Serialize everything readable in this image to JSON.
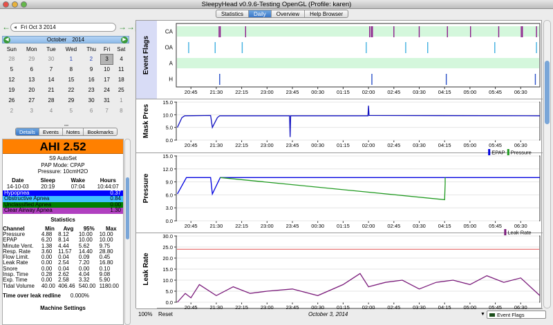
{
  "window": {
    "title": "SleepyHead v0.9.6-Testing OpenGL (Profile: karen)"
  },
  "tabs": [
    "Statistics",
    "Daily",
    "Overview",
    "Help Browser"
  ],
  "selected_tab": "Daily",
  "date_field": "Fri Oct 3 2014",
  "calendar": {
    "month": "October",
    "year": "2014",
    "weekdays": [
      "Sun",
      "Mon",
      "Tue",
      "Wed",
      "Thu",
      "Fri",
      "Sat"
    ],
    "weeks": [
      [
        "28",
        "29",
        "30",
        "1",
        "2",
        "3",
        "4"
      ],
      [
        "5",
        "6",
        "7",
        "8",
        "9",
        "10",
        "11"
      ],
      [
        "12",
        "13",
        "14",
        "15",
        "16",
        "17",
        "18"
      ],
      [
        "19",
        "20",
        "21",
        "22",
        "23",
        "24",
        "25"
      ],
      [
        "26",
        "27",
        "28",
        "29",
        "30",
        "31",
        "1"
      ],
      [
        "2",
        "3",
        "4",
        "5",
        "6",
        "7",
        "8"
      ]
    ],
    "selected": "3"
  },
  "left_tabs": [
    "Details",
    "Events",
    "Notes",
    "Bookmarks"
  ],
  "details": {
    "ahi_label": "AHI 2.52",
    "ahi_color": "#ff8000",
    "machine": "S9 AutoSet",
    "pap_mode": "PAP Mode: CPAP",
    "pressure": "Pressure: 10cmH2O",
    "session_headers": [
      "Date",
      "Sleep",
      "Wake",
      "Hours"
    ],
    "session_values": [
      "14-10-03",
      "20:19",
      "07:04",
      "10:44:07"
    ],
    "indices": [
      {
        "label": "Hypopnea",
        "value": "0.37",
        "color": "#0000ff",
        "text": "#ffffff"
      },
      {
        "label": "Obstructive Apnea",
        "value": "0.84",
        "color": "#40c0ff",
        "text": "#000000"
      },
      {
        "label": "Unclassified Apnea",
        "value": "0.00",
        "color": "#008000",
        "text": "#000000"
      },
      {
        "label": "Clear Airway Apnea",
        "value": "1.30",
        "color": "#b040c0",
        "text": "#000000"
      }
    ],
    "stats_title": "Statistics",
    "stats_headers": [
      "Channel",
      "Min",
      "Avg",
      "95%",
      "Max"
    ],
    "stats_rows": [
      [
        "Pressure",
        "4.88",
        "8.12",
        "10.00",
        "10.00"
      ],
      [
        "EPAP",
        "6.20",
        "8.14",
        "10.00",
        "10.00"
      ],
      [
        "Minute Vent.",
        "1.38",
        "4.44",
        "5.62",
        "9.75"
      ],
      [
        "Resp. Rate",
        "3.60",
        "11.57",
        "14.40",
        "28.80"
      ],
      [
        "Flow Limit.",
        "0.00",
        "0.04",
        "0.09",
        "0.45"
      ],
      [
        "Leak Rate",
        "0.00",
        "2.54",
        "7.20",
        "16.80"
      ],
      [
        "Snore",
        "0.00",
        "0.04",
        "0.00",
        "0.10"
      ],
      [
        "Insp. Time",
        "0.28",
        "2.62",
        "4.04",
        "9.08"
      ],
      [
        "Exp. Time",
        "0.00",
        "2.58",
        "3.32",
        "5.90"
      ],
      [
        "Tidal Volume",
        "40.00",
        "406.46",
        "540.00",
        "1180.00"
      ]
    ],
    "leak_label": "Time over leak redline",
    "leak_value": "0.000%",
    "machine_settings": "Machine Settings"
  },
  "time_ticks": [
    "20:45",
    "21:30",
    "22:15",
    "23:00",
    "23:45",
    "00:30",
    "01:15",
    "02:00",
    "02:45",
    "03:30",
    "04:15",
    "05:00",
    "05:45",
    "06:30"
  ],
  "chart_data": [
    {
      "type": "event-flags",
      "title": "Event Flags",
      "rows": [
        "CA",
        "OA",
        "A",
        "H"
      ],
      "colors": {
        "CA": "#8b1a8b",
        "OA": "#40b0e0",
        "H": "#2a50c8"
      },
      "events": {
        "CA": [
          "21:35",
          "21:37",
          "22:22",
          "02:02",
          "02:05",
          "02:07",
          "02:45",
          "03:30",
          "04:20",
          "05:01",
          "05:51",
          "06:31",
          "06:33",
          "06:58"
        ],
        "OA": [
          "20:41",
          "21:28",
          "22:16",
          "01:56",
          "03:06",
          "03:45",
          "05:44",
          "06:58"
        ],
        "H": [
          "21:36",
          "02:06",
          "04:18",
          "06:56"
        ]
      }
    },
    {
      "type": "line",
      "title": "Mask Pres",
      "ylim": [
        0,
        15
      ],
      "yticks": [
        "0.0",
        "5.0",
        "10.0",
        "15.0"
      ],
      "series": [
        {
          "color": "#1010c0",
          "points": [
            [
              "20:21",
              5
            ],
            [
              "20:29",
              8.9
            ],
            [
              "20:34",
              9.6
            ],
            [
              "21:20",
              9.7
            ],
            [
              "21:23",
              5
            ],
            [
              "21:32",
              8.9
            ],
            [
              "21:36",
              9.6
            ],
            [
              "23:40",
              9.6
            ],
            [
              "23:41",
              1.2
            ],
            [
              "23:42",
              9.6
            ],
            [
              "01:59",
              9.6
            ],
            [
              "02:00",
              13.6
            ],
            [
              "02:01",
              9.7
            ],
            [
              "07:04",
              9.6
            ]
          ]
        }
      ]
    },
    {
      "type": "line",
      "title": "Pressure",
      "ylim": [
        0,
        15
      ],
      "yticks": [
        "0.0",
        "3.0",
        "6.0",
        "9.0",
        "12.0",
        "15.0"
      ],
      "legend": [
        "EPAP",
        "Pressure"
      ],
      "series": [
        {
          "name": "EPAP",
          "color": "#0000e0",
          "points": [
            [
              "20:21",
              6.2
            ],
            [
              "20:37",
              10
            ],
            [
              "21:20",
              10
            ],
            [
              "21:23",
              6.2
            ],
            [
              "21:37",
              10
            ],
            [
              "07:04",
              10
            ]
          ]
        },
        {
          "name": "Pressure",
          "color": "#209a20",
          "points": [
            [
              "21:37",
              10
            ],
            [
              "04:15",
              4.88
            ],
            [
              "04:16",
              8.6
            ],
            [
              "04:16",
              10
            ]
          ]
        }
      ]
    },
    {
      "type": "line",
      "title": "Leak Rate",
      "ylim": [
        0,
        30
      ],
      "yticks": [
        "0.0",
        "5.0",
        "10.0",
        "15.0",
        "20.0",
        "25.0",
        "30.0"
      ],
      "legend": [
        "Leak Rate"
      ],
      "redline": 24,
      "series": [
        {
          "name": "Leak Rate",
          "color": "#7a1a7a",
          "points": [
            [
              "20:21",
              0
            ],
            [
              "20:35",
              4
            ],
            [
              "20:45",
              2
            ],
            [
              "21:00",
              8
            ],
            [
              "21:30",
              3
            ],
            [
              "22:00",
              7
            ],
            [
              "22:30",
              4
            ],
            [
              "23:00",
              5
            ],
            [
              "23:45",
              6
            ],
            [
              "00:30",
              3
            ],
            [
              "01:15",
              8
            ],
            [
              "01:45",
              13
            ],
            [
              "02:00",
              7
            ],
            [
              "02:30",
              9
            ],
            [
              "03:00",
              10
            ],
            [
              "03:30",
              6
            ],
            [
              "04:00",
              9
            ],
            [
              "04:30",
              10
            ],
            [
              "05:00",
              8
            ],
            [
              "05:30",
              12
            ],
            [
              "06:00",
              9
            ],
            [
              "06:30",
              11
            ],
            [
              "07:04",
              3
            ]
          ]
        }
      ]
    }
  ],
  "bottom": {
    "zoom": "100%",
    "reset": "Reset",
    "date": "October 3, 2014",
    "event_dropdown": "Event Flags"
  }
}
